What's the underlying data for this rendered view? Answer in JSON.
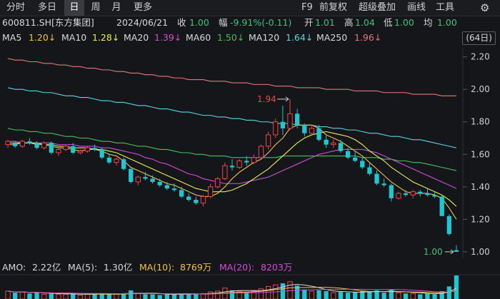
{
  "tabs": [
    {
      "label": "分时",
      "active": false
    },
    {
      "label": "多日",
      "active": false
    },
    {
      "label": "日",
      "active": true
    },
    {
      "label": "周",
      "active": false
    },
    {
      "label": "月",
      "active": false
    },
    {
      "label": "更多",
      "active": false
    }
  ],
  "right_menu": [
    "F9",
    "前复权",
    "超级叠加",
    "画线",
    "工具"
  ],
  "settings_icon": "gear-icon",
  "quote": {
    "code": "600811.SH[东方集团]",
    "date": "2024/06/21",
    "close_label": "收",
    "close": "1.00",
    "change_label": "幅",
    "change": "-9.91%(-0.11)",
    "open_label": "开",
    "open": "1.01",
    "high_label": "高",
    "high": "1.04",
    "low_label": "低",
    "low": "1.00",
    "avg_label": "均",
    "avg": "1.00"
  },
  "ma": [
    {
      "label": "MA5",
      "value": "1.20↓"
    },
    {
      "label": "MA10",
      "value": "1.28↓"
    },
    {
      "label": "MA20",
      "value": "1.39↓"
    },
    {
      "label": "MA60",
      "value": "1.50↓"
    },
    {
      "label": "MA120",
      "value": "1.64↓"
    },
    {
      "label": "MA250",
      "value": "1.96↓"
    }
  ],
  "days_label": "(64日)",
  "colors": {
    "up": "#e8484b",
    "down": "#20c7d3",
    "ma5": "#f3c14a",
    "ma10": "#f0ec5a",
    "ma20": "#d44cd6",
    "ma60": "#45c15b",
    "ma120": "#5fd3e0",
    "ma250": "#e07a7a",
    "bg": "#15161a"
  },
  "chart_data": {
    "type": "candlestick",
    "y_ticks": [
      "2.20",
      "2.00",
      "1.80",
      "1.60",
      "1.40",
      "1.20",
      "1.00"
    ],
    "ylim": [
      0.96,
      2.26
    ],
    "high_marker": "1.94",
    "low_marker": "1.00",
    "candles": [
      [
        1.66,
        1.69,
        1.64,
        1.68
      ],
      [
        1.67,
        1.68,
        1.64,
        1.65
      ],
      [
        1.65,
        1.69,
        1.64,
        1.68
      ],
      [
        1.68,
        1.7,
        1.66,
        1.67
      ],
      [
        1.67,
        1.68,
        1.63,
        1.64
      ],
      [
        1.64,
        1.68,
        1.63,
        1.67
      ],
      [
        1.67,
        1.68,
        1.6,
        1.61
      ],
      [
        1.61,
        1.64,
        1.59,
        1.63
      ],
      [
        1.63,
        1.66,
        1.62,
        1.65
      ],
      [
        1.65,
        1.67,
        1.6,
        1.61
      ],
      [
        1.61,
        1.63,
        1.6,
        1.62
      ],
      [
        1.62,
        1.65,
        1.61,
        1.64
      ],
      [
        1.64,
        1.66,
        1.62,
        1.63
      ],
      [
        1.63,
        1.64,
        1.57,
        1.58
      ],
      [
        1.58,
        1.6,
        1.54,
        1.55
      ],
      [
        1.55,
        1.58,
        1.53,
        1.57
      ],
      [
        1.57,
        1.58,
        1.5,
        1.51
      ],
      [
        1.51,
        1.52,
        1.42,
        1.43
      ],
      [
        1.43,
        1.47,
        1.41,
        1.46
      ],
      [
        1.46,
        1.49,
        1.44,
        1.45
      ],
      [
        1.45,
        1.47,
        1.42,
        1.43
      ],
      [
        1.43,
        1.45,
        1.4,
        1.41
      ],
      [
        1.41,
        1.43,
        1.38,
        1.39
      ],
      [
        1.39,
        1.42,
        1.37,
        1.38
      ],
      [
        1.38,
        1.4,
        1.33,
        1.34
      ],
      [
        1.34,
        1.36,
        1.31,
        1.32
      ],
      [
        1.32,
        1.34,
        1.29,
        1.3
      ],
      [
        1.3,
        1.35,
        1.28,
        1.34
      ],
      [
        1.34,
        1.42,
        1.33,
        1.4
      ],
      [
        1.4,
        1.46,
        1.39,
        1.45
      ],
      [
        1.45,
        1.55,
        1.44,
        1.53
      ],
      [
        1.53,
        1.57,
        1.5,
        1.52
      ],
      [
        1.52,
        1.57,
        1.51,
        1.56
      ],
      [
        1.56,
        1.59,
        1.53,
        1.55
      ],
      [
        1.55,
        1.6,
        1.54,
        1.58
      ],
      [
        1.58,
        1.66,
        1.57,
        1.65
      ],
      [
        1.65,
        1.74,
        1.63,
        1.72
      ],
      [
        1.72,
        1.82,
        1.7,
        1.8
      ],
      [
        1.8,
        1.9,
        1.72,
        1.76
      ],
      [
        1.76,
        1.94,
        1.75,
        1.85
      ],
      [
        1.85,
        1.88,
        1.76,
        1.78
      ],
      [
        1.78,
        1.79,
        1.71,
        1.73
      ],
      [
        1.73,
        1.78,
        1.72,
        1.76
      ],
      [
        1.76,
        1.78,
        1.68,
        1.69
      ],
      [
        1.69,
        1.72,
        1.64,
        1.66
      ],
      [
        1.66,
        1.69,
        1.64,
        1.67
      ],
      [
        1.67,
        1.69,
        1.61,
        1.62
      ],
      [
        1.62,
        1.64,
        1.57,
        1.58
      ],
      [
        1.58,
        1.62,
        1.55,
        1.56
      ],
      [
        1.56,
        1.58,
        1.51,
        1.52
      ],
      [
        1.52,
        1.55,
        1.47,
        1.48
      ],
      [
        1.48,
        1.5,
        1.41,
        1.42
      ],
      [
        1.42,
        1.45,
        1.4,
        1.41
      ],
      [
        1.41,
        1.42,
        1.31,
        1.33
      ],
      [
        1.33,
        1.37,
        1.32,
        1.36
      ],
      [
        1.36,
        1.38,
        1.34,
        1.35
      ],
      [
        1.35,
        1.38,
        1.33,
        1.37
      ],
      [
        1.37,
        1.38,
        1.34,
        1.36
      ],
      [
        1.36,
        1.39,
        1.34,
        1.35
      ],
      [
        1.35,
        1.37,
        1.33,
        1.34
      ],
      [
        1.34,
        1.35,
        1.28,
        1.22
      ],
      [
        1.22,
        1.23,
        1.1,
        1.11
      ],
      [
        1.01,
        1.04,
        1.0,
        1.0
      ]
    ],
    "ma5": [
      1.66,
      1.66,
      1.67,
      1.67,
      1.66,
      1.66,
      1.65,
      1.64,
      1.64,
      1.63,
      1.62,
      1.63,
      1.63,
      1.62,
      1.6,
      1.59,
      1.56,
      1.52,
      1.5,
      1.48,
      1.46,
      1.44,
      1.42,
      1.41,
      1.39,
      1.37,
      1.35,
      1.34,
      1.34,
      1.36,
      1.4,
      1.45,
      1.49,
      1.52,
      1.55,
      1.57,
      1.61,
      1.66,
      1.7,
      1.76,
      1.78,
      1.78,
      1.78,
      1.76,
      1.72,
      1.7,
      1.68,
      1.65,
      1.62,
      1.59,
      1.55,
      1.51,
      1.47,
      1.43,
      1.4,
      1.37,
      1.36,
      1.36,
      1.36,
      1.35,
      1.33,
      1.27,
      1.2
    ],
    "ma10": [
      1.67,
      1.67,
      1.67,
      1.67,
      1.67,
      1.66,
      1.66,
      1.65,
      1.65,
      1.64,
      1.64,
      1.64,
      1.63,
      1.63,
      1.62,
      1.61,
      1.59,
      1.57,
      1.55,
      1.53,
      1.51,
      1.49,
      1.47,
      1.45,
      1.43,
      1.41,
      1.39,
      1.38,
      1.37,
      1.37,
      1.37,
      1.38,
      1.4,
      1.42,
      1.45,
      1.48,
      1.51,
      1.55,
      1.59,
      1.63,
      1.67,
      1.7,
      1.72,
      1.73,
      1.74,
      1.73,
      1.72,
      1.71,
      1.69,
      1.66,
      1.62,
      1.59,
      1.56,
      1.52,
      1.49,
      1.46,
      1.43,
      1.41,
      1.39,
      1.37,
      1.35,
      1.32,
      1.28
    ],
    "ma20": [
      1.68,
      1.68,
      1.67,
      1.67,
      1.67,
      1.67,
      1.67,
      1.66,
      1.66,
      1.66,
      1.65,
      1.65,
      1.65,
      1.64,
      1.64,
      1.63,
      1.62,
      1.61,
      1.6,
      1.58,
      1.57,
      1.55,
      1.54,
      1.52,
      1.5,
      1.48,
      1.47,
      1.45,
      1.44,
      1.43,
      1.42,
      1.42,
      1.42,
      1.43,
      1.44,
      1.45,
      1.46,
      1.48,
      1.5,
      1.52,
      1.54,
      1.56,
      1.58,
      1.6,
      1.61,
      1.62,
      1.63,
      1.63,
      1.63,
      1.63,
      1.62,
      1.61,
      1.59,
      1.57,
      1.55,
      1.53,
      1.51,
      1.49,
      1.47,
      1.45,
      1.43,
      1.41,
      1.39
    ],
    "ma60": [
      1.76,
      1.75,
      1.75,
      1.74,
      1.74,
      1.73,
      1.73,
      1.72,
      1.71,
      1.71,
      1.7,
      1.7,
      1.69,
      1.68,
      1.68,
      1.67,
      1.67,
      1.66,
      1.65,
      1.65,
      1.64,
      1.63,
      1.63,
      1.62,
      1.61,
      1.61,
      1.6,
      1.6,
      1.59,
      1.59,
      1.59,
      1.58,
      1.58,
      1.58,
      1.58,
      1.58,
      1.58,
      1.58,
      1.59,
      1.59,
      1.59,
      1.59,
      1.59,
      1.59,
      1.59,
      1.59,
      1.59,
      1.59,
      1.59,
      1.58,
      1.58,
      1.58,
      1.57,
      1.57,
      1.56,
      1.56,
      1.55,
      1.55,
      1.54,
      1.53,
      1.52,
      1.51,
      1.5
    ],
    "ma120": [
      2.01,
      2.0,
      2.0,
      1.99,
      1.99,
      1.98,
      1.98,
      1.97,
      1.96,
      1.96,
      1.95,
      1.95,
      1.94,
      1.93,
      1.93,
      1.92,
      1.92,
      1.91,
      1.9,
      1.9,
      1.89,
      1.88,
      1.88,
      1.87,
      1.86,
      1.86,
      1.85,
      1.84,
      1.84,
      1.83,
      1.83,
      1.82,
      1.82,
      1.81,
      1.81,
      1.8,
      1.8,
      1.79,
      1.79,
      1.79,
      1.78,
      1.78,
      1.78,
      1.77,
      1.77,
      1.76,
      1.76,
      1.75,
      1.75,
      1.74,
      1.73,
      1.73,
      1.72,
      1.71,
      1.71,
      1.7,
      1.69,
      1.69,
      1.68,
      1.67,
      1.66,
      1.65,
      1.64
    ],
    "ma250": [
      2.19,
      2.18,
      2.18,
      2.17,
      2.17,
      2.16,
      2.16,
      2.15,
      2.15,
      2.14,
      2.14,
      2.13,
      2.13,
      2.12,
      2.12,
      2.11,
      2.11,
      2.1,
      2.1,
      2.09,
      2.09,
      2.08,
      2.08,
      2.07,
      2.07,
      2.06,
      2.06,
      2.06,
      2.05,
      2.05,
      2.05,
      2.04,
      2.04,
      2.04,
      2.03,
      2.03,
      2.03,
      2.02,
      2.02,
      2.02,
      2.01,
      2.01,
      2.01,
      2.01,
      2.0,
      2.0,
      2.0,
      2.0,
      1.99,
      1.99,
      1.99,
      1.99,
      1.98,
      1.98,
      1.98,
      1.98,
      1.97,
      1.97,
      1.97,
      1.97,
      1.96,
      1.96,
      1.96
    ]
  },
  "amo": {
    "label": "AMO:",
    "value": "2.22亿",
    "ma5_label": "MA(5):",
    "ma5": "1.30亿",
    "ma10_label": "MA(10):",
    "ma10": "8769万",
    "ma20_label": "MA(20):",
    "ma20": "8203万",
    "volumes": [
      0.5,
      0.4,
      0.45,
      0.35,
      0.4,
      0.3,
      0.35,
      0.3,
      0.3,
      0.35,
      0.25,
      0.3,
      0.3,
      0.35,
      0.3,
      0.3,
      0.35,
      0.55,
      0.35,
      0.3,
      0.3,
      0.25,
      0.3,
      0.3,
      0.35,
      0.3,
      0.3,
      0.35,
      0.45,
      0.5,
      0.7,
      0.55,
      0.5,
      0.45,
      0.5,
      0.65,
      0.8,
      0.9,
      1.0,
      1.1,
      0.85,
      0.6,
      0.5,
      0.55,
      0.5,
      0.4,
      0.45,
      0.4,
      0.45,
      0.5,
      0.45,
      0.55,
      0.4,
      0.6,
      0.4,
      0.35,
      0.35,
      0.3,
      0.35,
      0.3,
      0.5,
      0.8,
      1.5
    ]
  }
}
